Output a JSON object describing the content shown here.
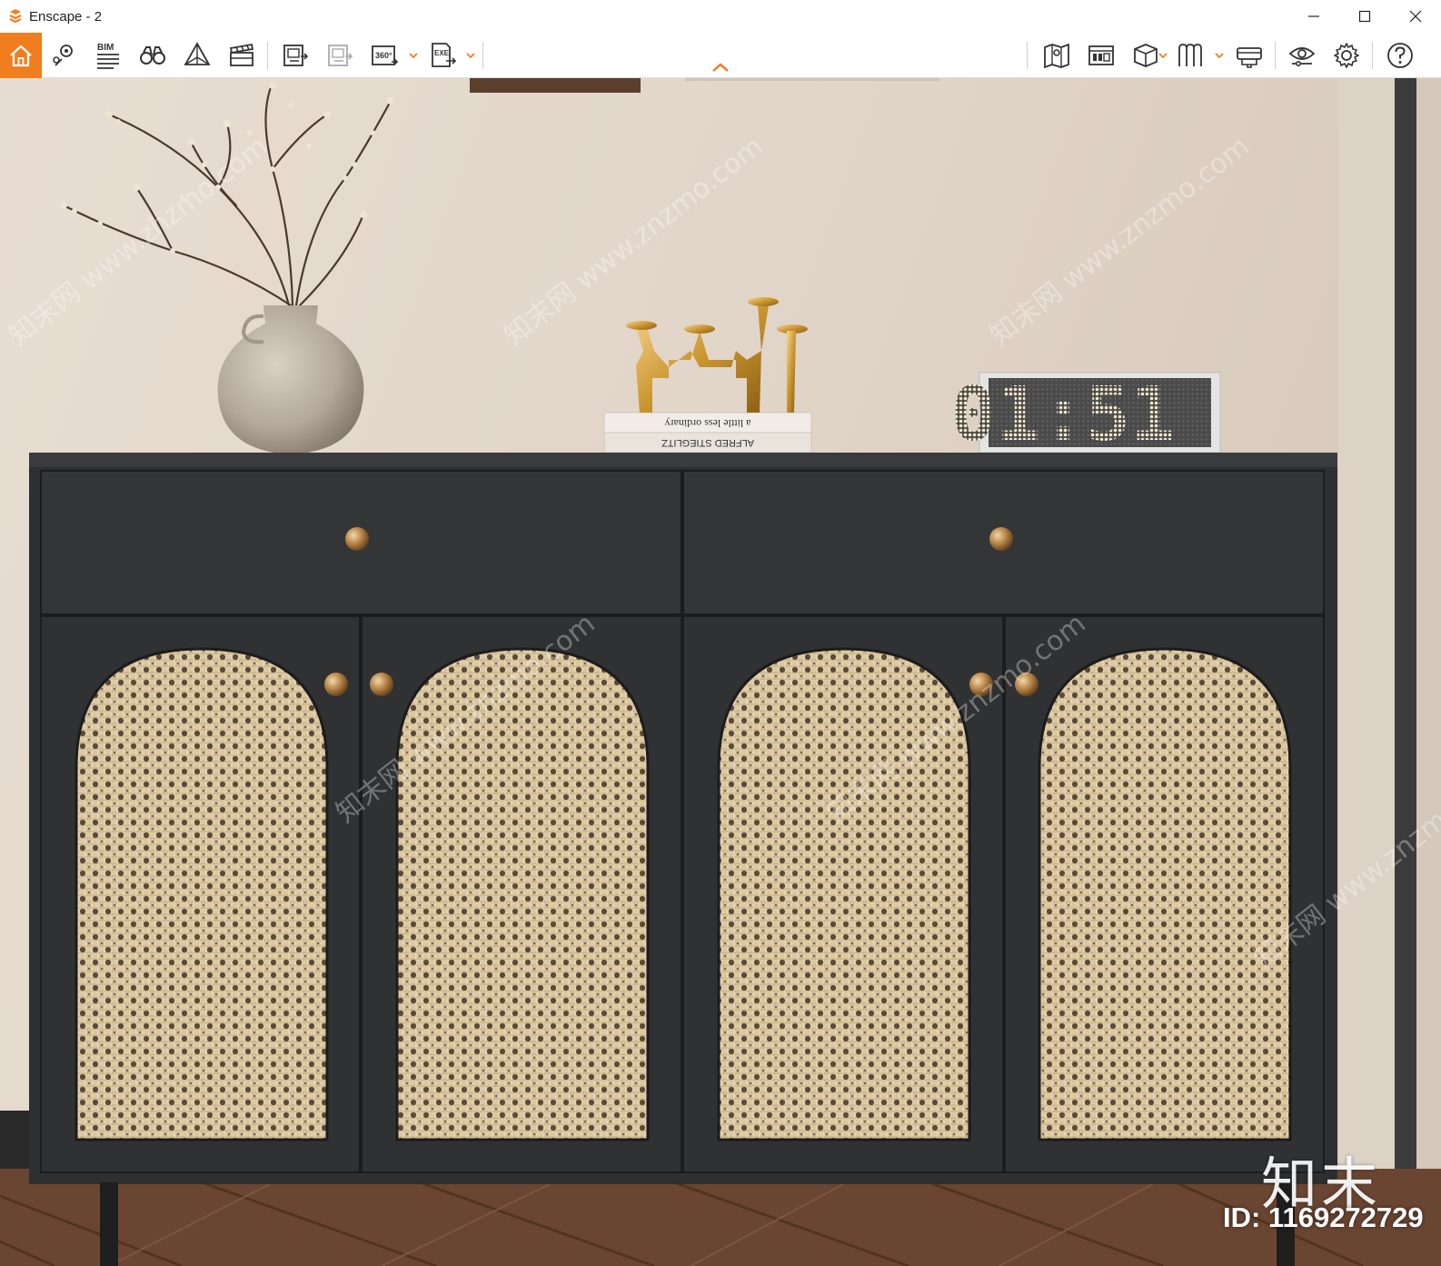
{
  "window": {
    "title": "Enscape - 2",
    "controls": [
      "minimize",
      "maximize",
      "close"
    ]
  },
  "toolbar": {
    "accent_color": "#f07d1e",
    "home_icon": "home-icon",
    "bim_label": "BIM",
    "pano_label": "360°",
    "exe_label": "EXE",
    "left_tools": [
      "home-icon",
      "map-pin-icon",
      "bim-list-icon",
      "binoculars-icon",
      "pyramid-icon",
      "clapper-icon",
      "batch-render-icon",
      "batch-render-disabled-icon",
      "panorama-360-icon",
      "export-exe-icon"
    ],
    "right_tools": [
      "map-view-icon",
      "asset-library-icon",
      "cube-view-icon",
      "material-editor-icon",
      "vr-headset-icon",
      "visual-settings-icon",
      "settings-gear-icon",
      "help-icon"
    ]
  },
  "viewport": {
    "scene": "render-preview",
    "book_line1": "a little less ordinary",
    "book_line2": "ALFRED STIEGLITZ",
    "clock_display": "01:51",
    "watermark_text": "知末网 www.znzmo.com",
    "brand_logo": "知末",
    "id_label": "ID: 1169272729"
  },
  "colors": {
    "wall": "#e3d8cc",
    "cabinet": "#2e2f31",
    "rattan": "#d8c5a0",
    "brass": "#b8864a",
    "floor": "#6a4632"
  }
}
